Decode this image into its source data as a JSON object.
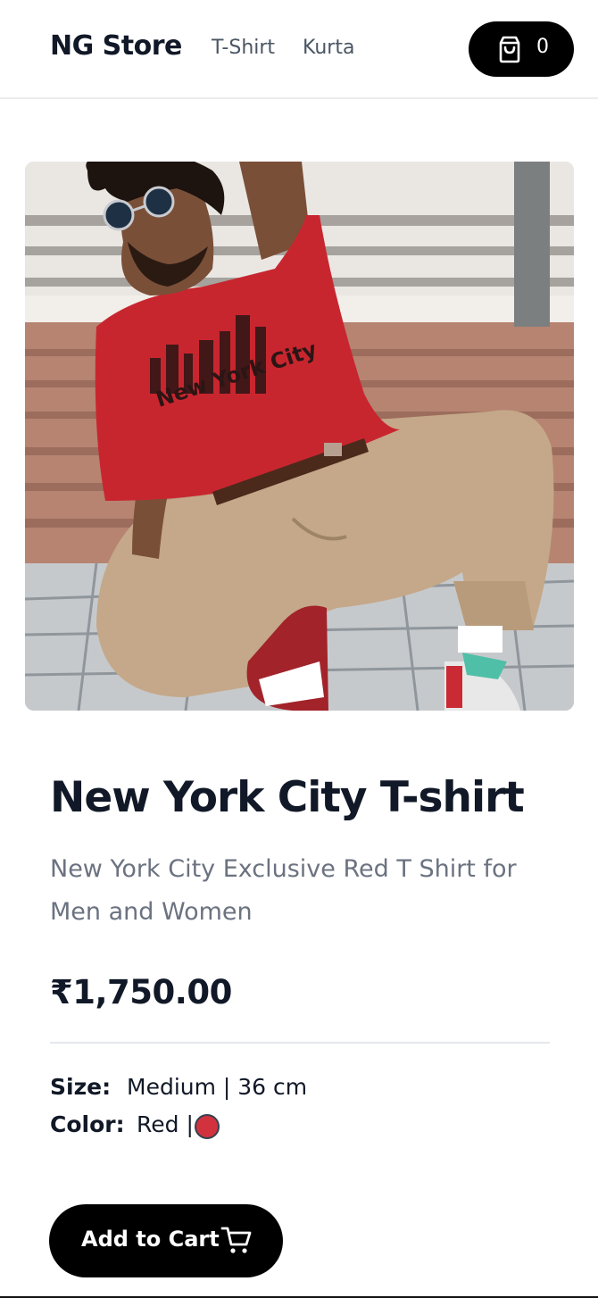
{
  "header": {
    "brand": "NG Store",
    "nav": [
      "T-Shirt",
      "Kurta"
    ],
    "cart_count": "0"
  },
  "product": {
    "image_icon": "product-photo",
    "print_text": "New York City",
    "title": "New York City T-shirt",
    "description": "New York City Exclusive Red T Shirt for Men and Women",
    "price": "₹1,750.00",
    "size_label": "Size:",
    "size_value": "Medium | 36 cm",
    "color_label": "Color:",
    "color_value": "Red |",
    "swatch_color": "#d1323d"
  },
  "actions": {
    "add_to_cart": "Add to Cart"
  },
  "colors": {
    "accent": "#000000",
    "muted_text": "#6b7280",
    "shirt_red": "#c8262f"
  }
}
